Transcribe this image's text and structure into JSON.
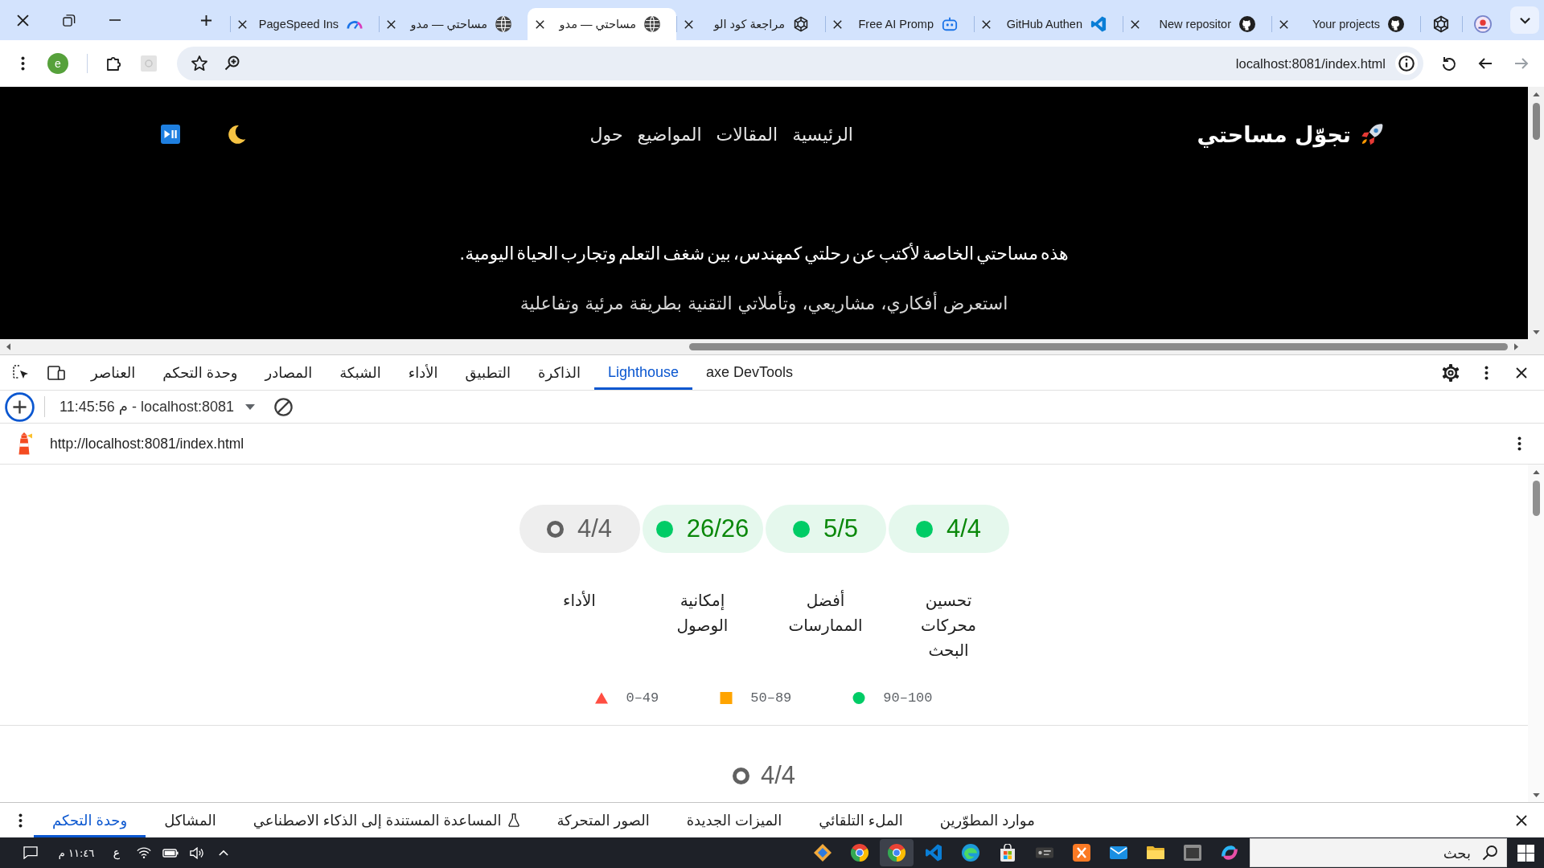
{
  "browser": {
    "tabs": [
      {
        "title": "Your projects",
        "selected": false
      },
      {
        "title": "New repositor",
        "selected": false
      },
      {
        "title": "GitHub Authen",
        "selected": false
      },
      {
        "title": "Free AI Promp",
        "selected": false
      },
      {
        "title": "مراجعة كود الو",
        "selected": false
      },
      {
        "title": "مساحتي — مدو",
        "selected": true
      },
      {
        "title": "مساحتي — مدو",
        "selected": false
      },
      {
        "title": "PageSpeed Ins",
        "selected": false
      }
    ],
    "profile_initial": "e",
    "address": "localhost:8081/index.html"
  },
  "page": {
    "brand": "تجوّل مساحتي",
    "nav": [
      "الرئيسية",
      "المقالات",
      "المواضيع",
      "حول"
    ],
    "hero": [
      "هذه مساحتي الخاصة لأكتب عن رحلتي كمهندس، بين شغف التعلم وتجارب الحياة اليومية.",
      "استعرض أفكاري، مشاريعي، وتأملاتي التقنية بطريقة مرئية وتفاعلية"
    ]
  },
  "devtools": {
    "tabs": [
      {
        "label": "axe DevTools",
        "selected": false
      },
      {
        "label": "Lighthouse",
        "selected": true
      },
      {
        "label": "الذاكرة",
        "selected": false
      },
      {
        "label": "التطبيق",
        "selected": false
      },
      {
        "label": "الأداء",
        "selected": false
      },
      {
        "label": "الشبكة",
        "selected": false
      },
      {
        "label": "المصادر",
        "selected": false
      },
      {
        "label": "وحدة التحكم",
        "selected": false
      },
      {
        "label": "العناصر",
        "selected": false
      }
    ],
    "report_selector": "11:45:56 م - localhost:8081",
    "report_url": "http://localhost:8081/index.html",
    "scores": [
      {
        "kind": "pass",
        "score": "4/4",
        "label": "تحسين محركات البحث"
      },
      {
        "kind": "pass",
        "score": "5/5",
        "label": "أفضل الممارسات"
      },
      {
        "kind": "pass",
        "score": "26/26",
        "label": "إمكانية الوصول"
      },
      {
        "kind": "neutral",
        "score": "4/4",
        "label": "الأداء"
      }
    ],
    "legend": [
      {
        "kind": "pass",
        "range": "90–100"
      },
      {
        "kind": "average",
        "range": "50–89"
      },
      {
        "kind": "fail",
        "range": "0–49"
      }
    ],
    "next_score": {
      "kind": "neutral",
      "score": "4/4"
    },
    "drawer_tabs": [
      {
        "label": "موارد المطوّرين",
        "kind": "plain",
        "selected": false
      },
      {
        "label": "الملء التلقائي",
        "kind": "plain",
        "selected": false
      },
      {
        "label": "الميزات الجديدة",
        "kind": "plain",
        "selected": false
      },
      {
        "label": "الصور المتحركة",
        "kind": "plain",
        "selected": false
      },
      {
        "label": "المساعدة المستندة إلى الذكاء الاصطناعي",
        "kind": "experiment",
        "selected": false
      },
      {
        "label": "المشاكل",
        "kind": "plain",
        "selected": false
      },
      {
        "label": "وحدة التحكم",
        "kind": "plain",
        "selected": true
      }
    ]
  },
  "taskbar": {
    "search": {
      "placeholder": "بحث"
    },
    "apps": [
      {
        "selected": false
      },
      {
        "selected": false
      },
      {
        "selected": false
      },
      {
        "selected": false
      },
      {
        "selected": false
      },
      {
        "selected": false
      },
      {
        "selected": false
      },
      {
        "selected": false
      },
      {
        "selected": false
      },
      {
        "selected": true
      },
      {
        "selected": false
      },
      {
        "selected": false
      }
    ],
    "language": "ع",
    "clock": "١١:٤٦ م"
  }
}
